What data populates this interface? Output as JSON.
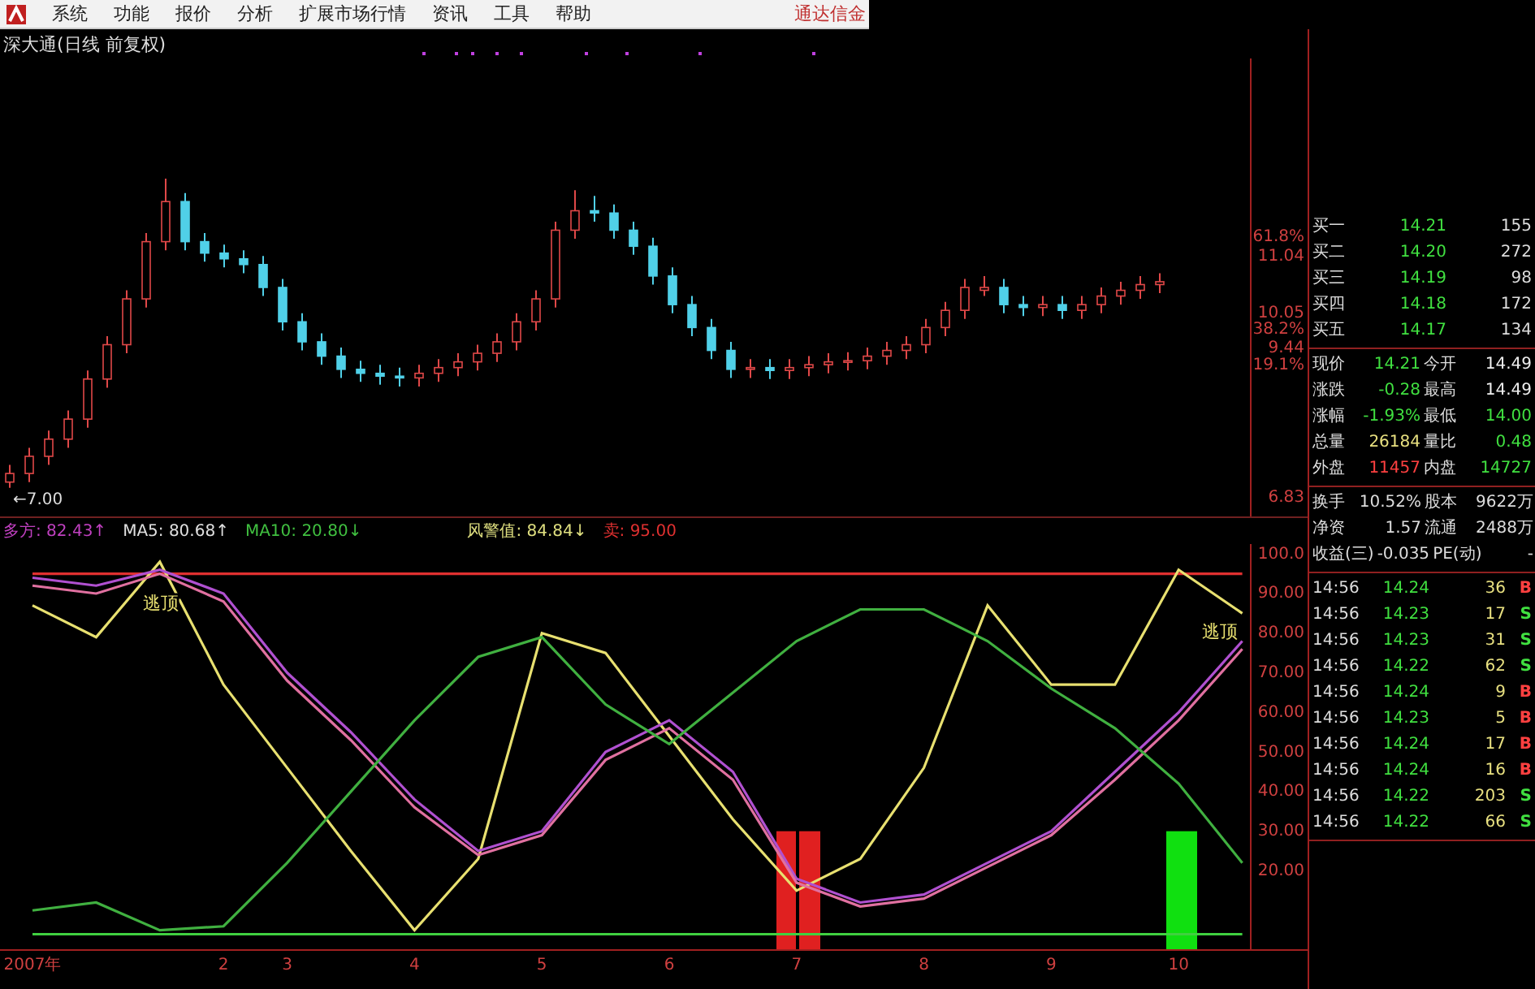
{
  "menu": {
    "items": [
      "系统",
      "功能",
      "报价",
      "分析",
      "扩展市场行情",
      "资讯",
      "工具",
      "帮助"
    ],
    "brand": "通达信金"
  },
  "title": "深大通(日线 前复权)",
  "price_chart": {
    "ratio_labels": [
      "61.8%",
      "38.2%",
      "19.1%"
    ],
    "low_marker": "←7.00",
    "chart_data": {
      "type": "candlestick",
      "categories": [
        null,
        null,
        null,
        null,
        null,
        null,
        null,
        null,
        null,
        null,
        null,
        null,
        null,
        null,
        null,
        null,
        null,
        null,
        null,
        null,
        null,
        null,
        null,
        null,
        null,
        null,
        null,
        null,
        null,
        null,
        null,
        null,
        null,
        null,
        null,
        null,
        null,
        null,
        null,
        null,
        null,
        null,
        null,
        null,
        null,
        null,
        null,
        null,
        null,
        null,
        null,
        null,
        null,
        null,
        null,
        null,
        null,
        null,
        null,
        null
      ],
      "ylim": [
        6.5,
        14.5
      ],
      "yticks": [
        {
          "value": 6.83,
          "label": "6.83"
        },
        {
          "value": 9.44,
          "label": "9.44"
        },
        {
          "value": 10.05,
          "label": "10.05"
        },
        {
          "value": 11.04,
          "label": "11.04"
        }
      ],
      "ohlc": [
        [
          7.1,
          7.4,
          7.0,
          7.25
        ],
        [
          7.25,
          7.7,
          7.1,
          7.55
        ],
        [
          7.55,
          8.0,
          7.4,
          7.85
        ],
        [
          7.85,
          8.35,
          7.7,
          8.2
        ],
        [
          8.2,
          9.05,
          8.05,
          8.9
        ],
        [
          8.9,
          9.65,
          8.75,
          9.5
        ],
        [
          9.5,
          10.45,
          9.35,
          10.3
        ],
        [
          10.3,
          11.45,
          10.15,
          11.3
        ],
        [
          11.3,
          12.4,
          11.15,
          12.0
        ],
        [
          12.0,
          12.15,
          11.15,
          11.3
        ],
        [
          11.3,
          11.45,
          10.95,
          11.1
        ],
        [
          11.1,
          11.25,
          10.85,
          11.0
        ],
        [
          11.0,
          11.15,
          10.75,
          10.9
        ],
        [
          10.9,
          11.05,
          10.35,
          10.5
        ],
        [
          10.5,
          10.65,
          9.75,
          9.9
        ],
        [
          9.9,
          10.05,
          9.4,
          9.55
        ],
        [
          9.55,
          9.7,
          9.15,
          9.3
        ],
        [
          9.3,
          9.45,
          8.92,
          9.07
        ],
        [
          9.07,
          9.22,
          8.85,
          9.0
        ],
        [
          9.0,
          9.15,
          8.8,
          8.95
        ],
        [
          8.95,
          9.1,
          8.77,
          8.92
        ],
        [
          8.92,
          9.15,
          8.77,
          9.0
        ],
        [
          9.0,
          9.25,
          8.85,
          9.1
        ],
        [
          9.1,
          9.35,
          8.95,
          9.2
        ],
        [
          9.2,
          9.5,
          9.05,
          9.35
        ],
        [
          9.35,
          9.7,
          9.2,
          9.55
        ],
        [
          9.55,
          10.05,
          9.4,
          9.9
        ],
        [
          9.9,
          10.45,
          9.75,
          10.3
        ],
        [
          10.3,
          11.65,
          10.15,
          11.5
        ],
        [
          11.5,
          12.2,
          11.35,
          11.84
        ],
        [
          11.84,
          12.1,
          11.65,
          11.8
        ],
        [
          11.8,
          11.95,
          11.35,
          11.5
        ],
        [
          11.5,
          11.65,
          11.07,
          11.22
        ],
        [
          11.22,
          11.37,
          10.55,
          10.7
        ],
        [
          10.7,
          10.85,
          10.05,
          10.2
        ],
        [
          10.2,
          10.35,
          9.65,
          9.8
        ],
        [
          9.8,
          9.95,
          9.25,
          9.4
        ],
        [
          9.4,
          9.55,
          8.92,
          9.07
        ],
        [
          9.07,
          9.25,
          8.92,
          9.1
        ],
        [
          9.1,
          9.25,
          8.9,
          9.05
        ],
        [
          9.05,
          9.25,
          8.9,
          9.1
        ],
        [
          9.1,
          9.3,
          8.95,
          9.15
        ],
        [
          9.15,
          9.35,
          9.0,
          9.2
        ],
        [
          9.2,
          9.37,
          9.05,
          9.22
        ],
        [
          9.22,
          9.45,
          9.07,
          9.3
        ],
        [
          9.3,
          9.55,
          9.15,
          9.4
        ],
        [
          9.4,
          9.65,
          9.25,
          9.5
        ],
        [
          9.5,
          9.95,
          9.35,
          9.8
        ],
        [
          9.8,
          10.25,
          9.65,
          10.1
        ],
        [
          10.1,
          10.65,
          9.95,
          10.5
        ],
        [
          10.45,
          10.7,
          10.35,
          10.5
        ],
        [
          10.5,
          10.65,
          10.05,
          10.2
        ],
        [
          10.2,
          10.35,
          10.0,
          10.15
        ],
        [
          10.15,
          10.35,
          10.0,
          10.2
        ],
        [
          10.2,
          10.35,
          9.95,
          10.1
        ],
        [
          10.1,
          10.35,
          9.95,
          10.2
        ],
        [
          10.2,
          10.5,
          10.05,
          10.35
        ],
        [
          10.35,
          10.6,
          10.2,
          10.45
        ],
        [
          10.45,
          10.7,
          10.3,
          10.55
        ],
        [
          10.55,
          10.75,
          10.4,
          10.6
        ]
      ]
    }
  },
  "indicator": {
    "legend": [
      {
        "text": "多方: 82.43↑",
        "color": "#c040c0"
      },
      {
        "text": "MA5: 80.68↑",
        "color": "#e0e0e0"
      },
      {
        "text": "MA10: 20.80↓",
        "color": "#40c040"
      },
      {
        "text": "风警值: 84.84↓",
        "color": "#e0e080"
      },
      {
        "text": "卖: 95.00",
        "color": "#e03030"
      }
    ],
    "chart_data": {
      "type": "line",
      "categories": [
        "2007年",
        null,
        null,
        "2",
        "3",
        null,
        "4",
        null,
        "5",
        null,
        "6",
        null,
        "7",
        null,
        "8",
        null,
        "9",
        null,
        "10",
        null
      ],
      "ylim": [
        0,
        102.5
      ],
      "yticks": [
        {
          "value": 20,
          "label": "20.00"
        },
        {
          "value": 30,
          "label": "30.00"
        },
        {
          "value": 40,
          "label": "40.00"
        },
        {
          "value": 50,
          "label": "50.00"
        },
        {
          "value": 60,
          "label": "60.00"
        },
        {
          "value": 70,
          "label": "70.00"
        },
        {
          "value": 80,
          "label": "80.00"
        },
        {
          "value": 90,
          "label": "90.00"
        },
        {
          "value": 100,
          "label": "100.0"
        }
      ],
      "series": [
        {
          "color": "#e03030",
          "values": [
            95,
            95,
            95,
            95,
            95,
            95,
            95,
            95,
            95,
            95,
            95,
            95,
            95,
            95,
            95,
            95,
            95,
            95,
            95,
            95
          ]
        },
        {
          "color": "#40d040",
          "values": [
            4,
            4,
            4,
            4,
            4,
            4,
            4,
            4,
            4,
            4,
            4,
            4,
            4,
            4,
            4,
            4,
            4,
            4,
            4,
            4
          ]
        },
        {
          "color": "#e8e070",
          "values": [
            87,
            79,
            98,
            67,
            46,
            25,
            5,
            23,
            80,
            75,
            54,
            33,
            15,
            23,
            46,
            87,
            67,
            67,
            96,
            85
          ]
        },
        {
          "color": "#b050d0",
          "values": [
            94,
            92,
            96,
            90,
            70,
            55,
            38,
            25,
            30,
            50,
            58,
            45,
            18,
            12,
            14,
            22,
            30,
            45,
            60,
            78
          ]
        },
        {
          "color": "#e070a0",
          "values": [
            92,
            90,
            95,
            88,
            68,
            53,
            36,
            24,
            29,
            48,
            56,
            43,
            17,
            11,
            13,
            21,
            29,
            43,
            58,
            76
          ]
        },
        {
          "color": "#40b040",
          "values": [
            10,
            12,
            5,
            6,
            22,
            40,
            58,
            74,
            79,
            62,
            52,
            65,
            78,
            86,
            86,
            78,
            66,
            56,
            42,
            22
          ]
        }
      ],
      "annotations": [
        "逃顶",
        "逃顶"
      ]
    }
  },
  "quote": {
    "bids": [
      {
        "label": "买一",
        "price": "14.21",
        "volume": "155"
      },
      {
        "label": "买二",
        "price": "14.20",
        "volume": "272"
      },
      {
        "label": "买三",
        "price": "14.19",
        "volume": "98"
      },
      {
        "label": "买四",
        "price": "14.18",
        "volume": "172"
      },
      {
        "label": "买五",
        "price": "14.17",
        "volume": "134"
      }
    ],
    "stats": [
      {
        "label": "现价",
        "value": "14.21",
        "color": "#40e040"
      },
      {
        "label": "今开",
        "value": "14.49",
        "color": "#eeeeee"
      },
      {
        "label": "涨跌",
        "value": "-0.28",
        "color": "#40e040"
      },
      {
        "label": "最高",
        "value": "14.49",
        "color": "#eeeeee"
      },
      {
        "label": "涨幅",
        "value": "-1.93%",
        "color": "#40e040"
      },
      {
        "label": "最低",
        "value": "14.00",
        "color": "#40e040"
      },
      {
        "label": "总量",
        "value": "26184",
        "color": "#e8e080"
      },
      {
        "label": "量比",
        "value": "0.48",
        "color": "#40e040"
      },
      {
        "label": "外盘",
        "value": "11457",
        "color": "#ff4040"
      },
      {
        "label": "内盘",
        "value": "14727",
        "color": "#40e040"
      }
    ],
    "fundamentals": [
      {
        "label": "换手",
        "value": "10.52%"
      },
      {
        "label": "股本",
        "value": "9622万"
      },
      {
        "label": "净资",
        "value": "1.57"
      },
      {
        "label": "流通",
        "value": "2488万"
      },
      {
        "label": "收益(三)",
        "value": "-0.035"
      },
      {
        "label": "PE(动)",
        "value": "-"
      }
    ],
    "trades": [
      {
        "time": "14:56",
        "price": "14.24",
        "volume": "36",
        "side": "B",
        "kind": "buy"
      },
      {
        "time": "14:56",
        "price": "14.23",
        "volume": "17",
        "side": "S",
        "kind": "sell"
      },
      {
        "time": "14:56",
        "price": "14.23",
        "volume": "31",
        "side": "S",
        "kind": "sell"
      },
      {
        "time": "14:56",
        "price": "14.22",
        "volume": "62",
        "side": "S",
        "kind": "sell"
      },
      {
        "time": "14:56",
        "price": "14.24",
        "volume": "9",
        "side": "B",
        "kind": "buy"
      },
      {
        "time": "14:56",
        "price": "14.23",
        "volume": "5",
        "side": "B",
        "kind": "buy"
      },
      {
        "time": "14:56",
        "price": "14.24",
        "volume": "17",
        "side": "B",
        "kind": "buy"
      },
      {
        "time": "14:56",
        "price": "14.24",
        "volume": "16",
        "side": "B",
        "kind": "buy"
      },
      {
        "time": "14:56",
        "price": "14.22",
        "volume": "203",
        "side": "S",
        "kind": "sell"
      },
      {
        "time": "14:56",
        "price": "14.22",
        "volume": "66",
        "side": "S",
        "kind": "sell"
      }
    ]
  }
}
